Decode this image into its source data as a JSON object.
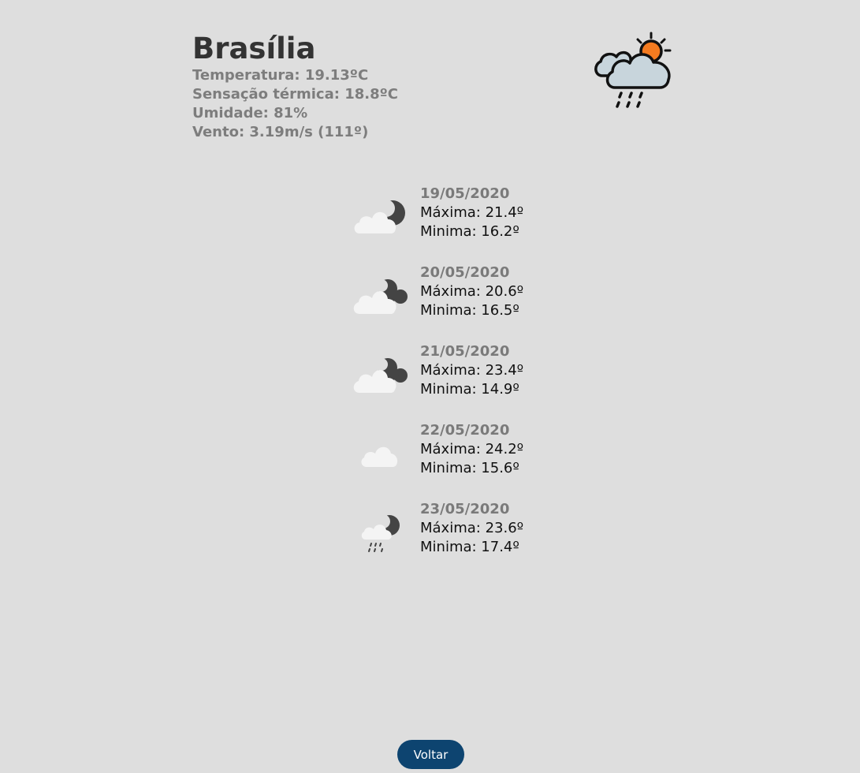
{
  "current": {
    "city": "Brasília",
    "temperature": "Temperatura: 19.13ºC",
    "feels_like": "Sensação térmica: 18.8ºC",
    "humidity": "Umidade: 81%",
    "wind": "Vento: 3.19m/s (111º)",
    "icon": "rain-cloud-sun-icon",
    "colors": {
      "sun": "#f47b20",
      "cloud": "#c8d5dc",
      "outline": "#111111"
    }
  },
  "forecast": [
    {
      "date": "19/05/2020",
      "max": "Máxima: 21.4º",
      "min": "Minima: 16.2º",
      "icon": "partly-cloudy-night-icon"
    },
    {
      "date": "20/05/2020",
      "max": "Máxima: 20.6º",
      "min": "Minima: 16.5º",
      "icon": "cloudy-night-icon"
    },
    {
      "date": "21/05/2020",
      "max": "Máxima: 23.4º",
      "min": "Minima: 14.9º",
      "icon": "cloudy-night-icon"
    },
    {
      "date": "22/05/2020",
      "max": "Máxima: 24.2º",
      "min": "Minima: 15.6º",
      "icon": "cloud-icon"
    },
    {
      "date": "23/05/2020",
      "max": "Máxima: 23.6º",
      "min": "Minima: 17.4º",
      "icon": "rain-night-icon"
    }
  ],
  "back_button": {
    "label": "Voltar",
    "color": "#0d4470"
  },
  "background": "#dedede"
}
